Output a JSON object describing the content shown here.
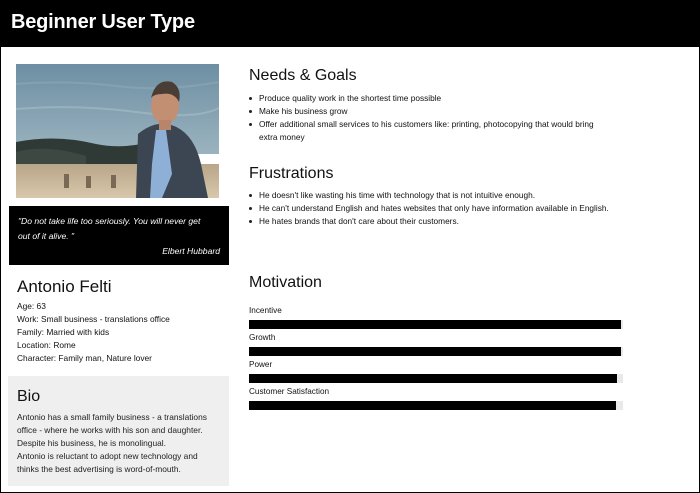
{
  "header": {
    "title": "Beginner User Type"
  },
  "quote": {
    "text_line1": "\"Do not take life too seriously. You will never get",
    "text_line2": "out of it alive. \"",
    "author": "Elbert Hubbard"
  },
  "persona": {
    "name": "Antonio Felti",
    "details": [
      "Age: 63",
      "Work: Small business - translations office",
      "Family: Married with kids",
      "Location: Rome",
      "Character: Family man, Nature lover"
    ]
  },
  "bio": {
    "title": "Bio",
    "lines": [
      "Antonio has a small family business - a translations",
      "office - where he works with his son and daughter.",
      "Despite his business, he is monolingual.",
      "Antonio is reluctant to adopt new technology and",
      "thinks the best advertising is word-of-mouth."
    ]
  },
  "needs_goals": {
    "title": "Needs & Goals",
    "items": [
      "Produce quality work in the shortest time possible",
      "Make his business grow",
      "Offer additional small services to his customers like: printing, photocopying that would bring extra money"
    ]
  },
  "frustrations": {
    "title": "Frustrations",
    "items": [
      "He doesn't like wasting his time with technology that is not intuitive enough.",
      "He can't understand English and hates websites that only have information available in English.",
      "He hates brands that don't care about their customers."
    ]
  },
  "motivation": {
    "title": "Motivation",
    "items": [
      {
        "label": "Incentive",
        "level": 0.995
      },
      {
        "label": "Growth",
        "level": 0.995
      },
      {
        "label": "Power",
        "level": 0.985
      },
      {
        "label": "Customer Satisfaction",
        "level": 0.98
      }
    ]
  },
  "colors": {
    "header_bg": "#000000",
    "bar_fill": "#000000",
    "bio_bg": "#efefef"
  }
}
